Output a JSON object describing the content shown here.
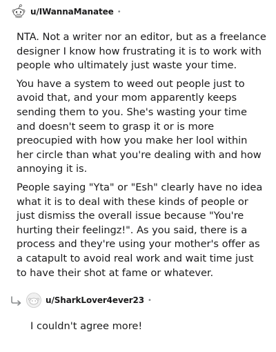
{
  "comment": {
    "username": "u/IWannaManatee",
    "separator": "•",
    "avatar_icon": "reddit-snoo-icon",
    "paragraphs": [
      "NTA. Not a writer nor an editor, but as a freelance designer I know how frustrating it is to work with people who ultimately just waste your time.",
      "You have a system to weed out people just to avoid that, and your mom apparently keeps sending them to you. She's wasting your time and doesn't seem to grasp it or is more preocupied with how you make her lool within her circle than what you're dealing with and how annoying it is.",
      "People saying \"Yta\" or \"Esh\" clearly have no idea what it is to deal with these kinds of people or just dismiss the overall issue because \"You're hurting their feelingz!\". As you said, there is a process and they're using your mother's offer as a catapult to avoid real work and wait time just to have their shot at fame or whatever."
    ]
  },
  "reply": {
    "username": "u/SharkLover4ever23",
    "separator": "•",
    "reply_icon": "reply-arrow-icon",
    "avatar_icon": "default-avatar-icon",
    "text": "I couldn't agree more!"
  }
}
